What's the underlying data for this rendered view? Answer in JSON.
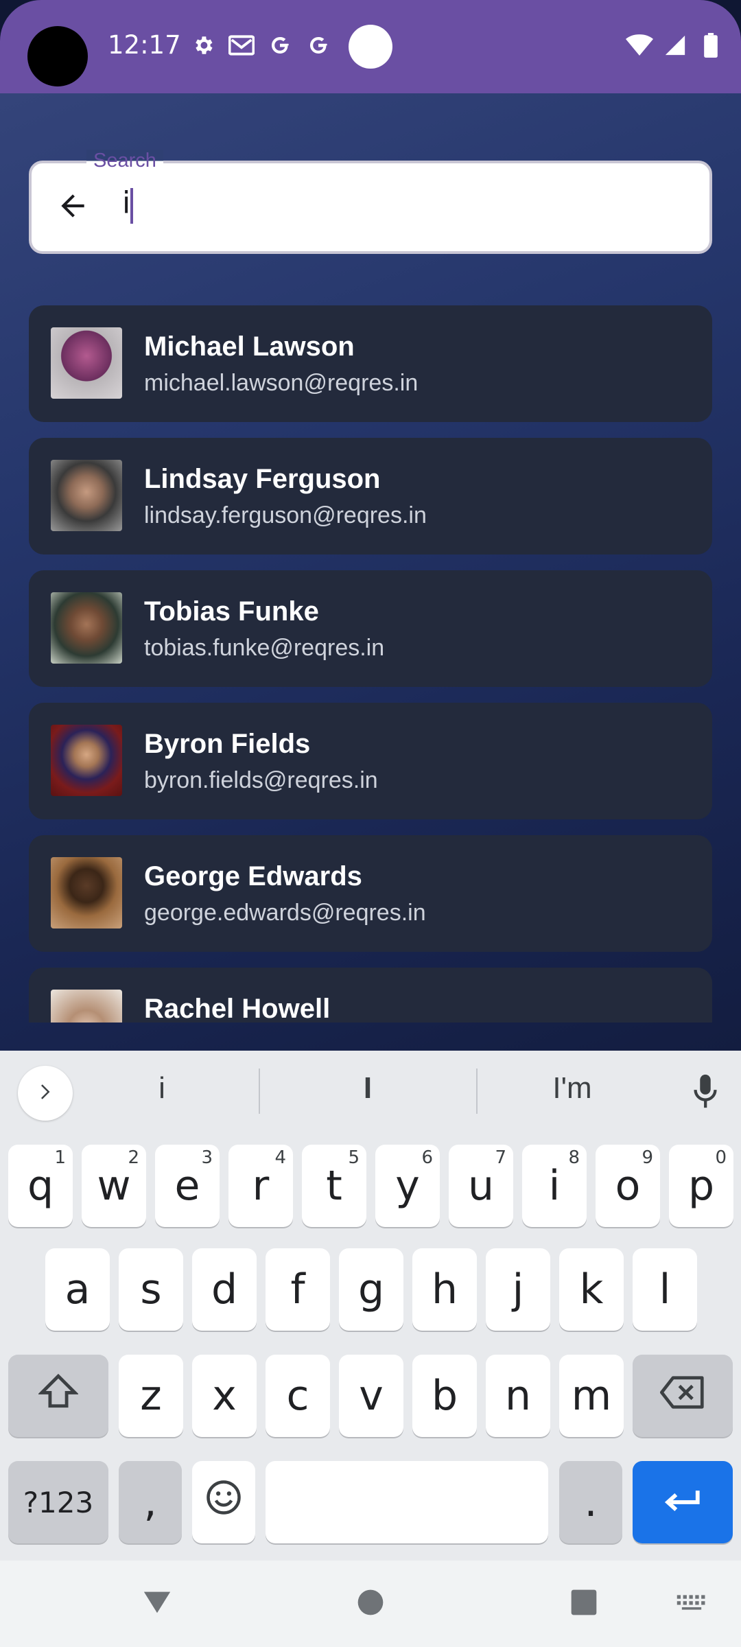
{
  "status_bar": {
    "time": "12:17",
    "icons_left": [
      "gear-icon",
      "mail-icon",
      "google-g-icon",
      "google-g-icon"
    ],
    "icons_right": [
      "wifi-icon",
      "signal-icon",
      "battery-icon"
    ],
    "bg_color": "#6a4fa3"
  },
  "search": {
    "label": "Search",
    "value": "i",
    "back_icon": "arrow-back-icon"
  },
  "users": [
    {
      "name": "Michael Lawson",
      "email": "michael.lawson@reqres.in"
    },
    {
      "name": "Lindsay Ferguson",
      "email": "lindsay.ferguson@reqres.in"
    },
    {
      "name": "Tobias Funke",
      "email": "tobias.funke@reqres.in"
    },
    {
      "name": "Byron Fields",
      "email": "byron.fields@reqres.in"
    },
    {
      "name": "George Edwards",
      "email": "george.edwards@reqres.in"
    },
    {
      "name": "Rachel Howell",
      "email": ""
    }
  ],
  "keyboard": {
    "suggestions": [
      "i",
      "I",
      "I'm"
    ],
    "row1": [
      {
        "k": "q",
        "h": "1"
      },
      {
        "k": "w",
        "h": "2"
      },
      {
        "k": "e",
        "h": "3"
      },
      {
        "k": "r",
        "h": "4"
      },
      {
        "k": "t",
        "h": "5"
      },
      {
        "k": "y",
        "h": "6"
      },
      {
        "k": "u",
        "h": "7"
      },
      {
        "k": "i",
        "h": "8"
      },
      {
        "k": "o",
        "h": "9"
      },
      {
        "k": "p",
        "h": "0"
      }
    ],
    "row2": [
      "a",
      "s",
      "d",
      "f",
      "g",
      "h",
      "j",
      "k",
      "l"
    ],
    "row3": [
      "z",
      "x",
      "c",
      "v",
      "b",
      "n",
      "m"
    ],
    "symbols_label": "?123",
    "comma_label": ",",
    "period_label": ".",
    "accent_color": "#1a73e8"
  },
  "navbar": {
    "items": [
      "back-triangle-icon",
      "home-circle-icon",
      "recents-square-icon",
      "keyboard-switch-icon"
    ]
  }
}
